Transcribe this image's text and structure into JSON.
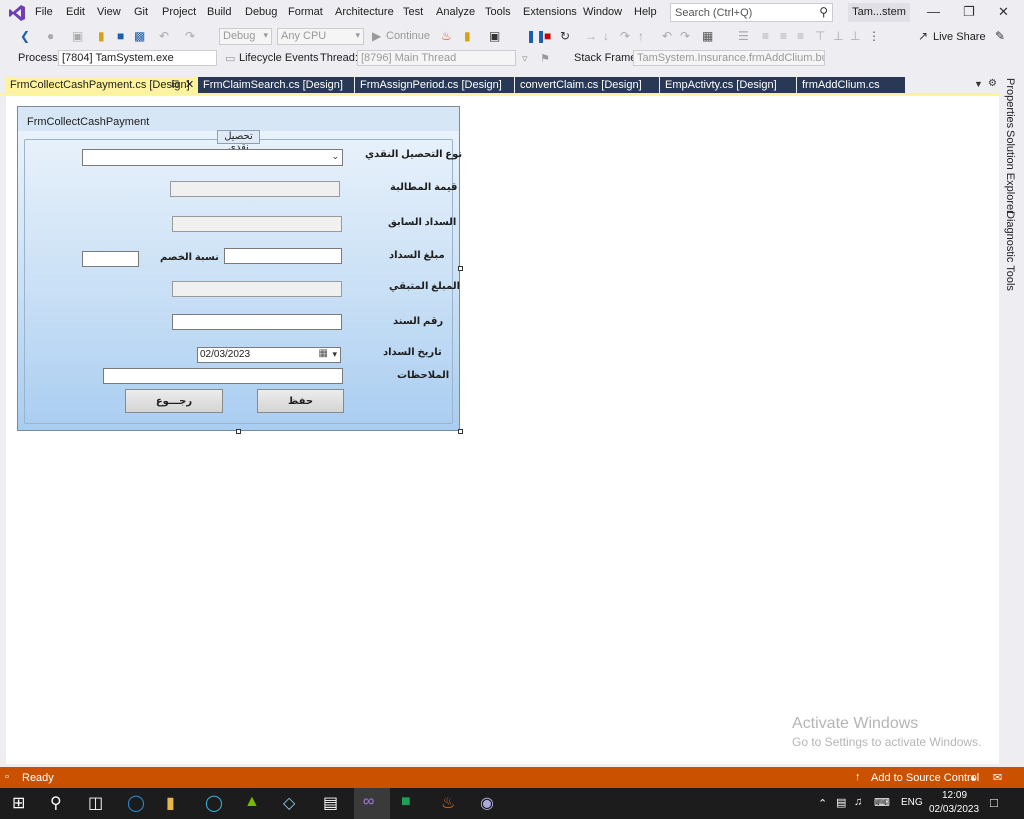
{
  "menu": [
    "File",
    "Edit",
    "View",
    "Git",
    "Project",
    "Build",
    "Debug",
    "Format",
    "Architecture",
    "Test",
    "Analyze",
    "Tools",
    "Extensions",
    "Window",
    "Help"
  ],
  "search": {
    "placeholder": "Search (Ctrl+Q)"
  },
  "solution_name": "Tam...stem",
  "toolbar": {
    "config": "Debug",
    "platform": "Any CPU",
    "continue_label": "Continue",
    "live_share": "Live Share"
  },
  "toolbar2": {
    "process_label": "Process:",
    "process_value": "[7804] TamSystem.exe",
    "lifecycle_label": "Lifecycle Events",
    "thread_label": "Thread:",
    "thread_value": "[8796] Main Thread",
    "stackframe_label": "Stack Frame:",
    "stackframe_value": "TamSystem.Insurance.frmAddClium.buttc"
  },
  "tabs": [
    {
      "label": "FrmCollectCashPayment.cs [Design]",
      "active": true
    },
    {
      "label": "FrmClaimSearch.cs [Design]"
    },
    {
      "label": "FrmAssignPeriod.cs [Design]"
    },
    {
      "label": "convertClaim.cs [Design]"
    },
    {
      "label": "EmpActivty.cs [Design]"
    },
    {
      "label": "frmAddClium.cs"
    }
  ],
  "side_panels": [
    "Properties",
    "Solution Explorer",
    "Diagnostic Tools"
  ],
  "form": {
    "title": "FrmCollectCashPayment",
    "group_caption": "تحصيل نقدي",
    "labels": {
      "collection_type": "نوع التحصيل النقدي",
      "claim_value": "قيمة المطالبة",
      "previous_payment": "السداد السابق",
      "payment_amount": "مبلغ السداد",
      "discount_ratio": "نسبة الخصم",
      "remaining_amount": "المبلغ المتبقي",
      "receipt_number": "رقم السند",
      "payment_date": "تاريخ السداد",
      "notes": "الملاحظات"
    },
    "date_value": "02/03/2023",
    "buttons": {
      "save": "حفظ",
      "back": "رجـــوع"
    }
  },
  "watermark": {
    "line1": "Activate Windows",
    "line2": "Go to Settings to activate Windows."
  },
  "status": {
    "ready": "Ready",
    "source_control": "Add to Source Control"
  },
  "taskbar": {
    "language": "ENG",
    "time": "12:09",
    "date": "02/03/2023"
  }
}
